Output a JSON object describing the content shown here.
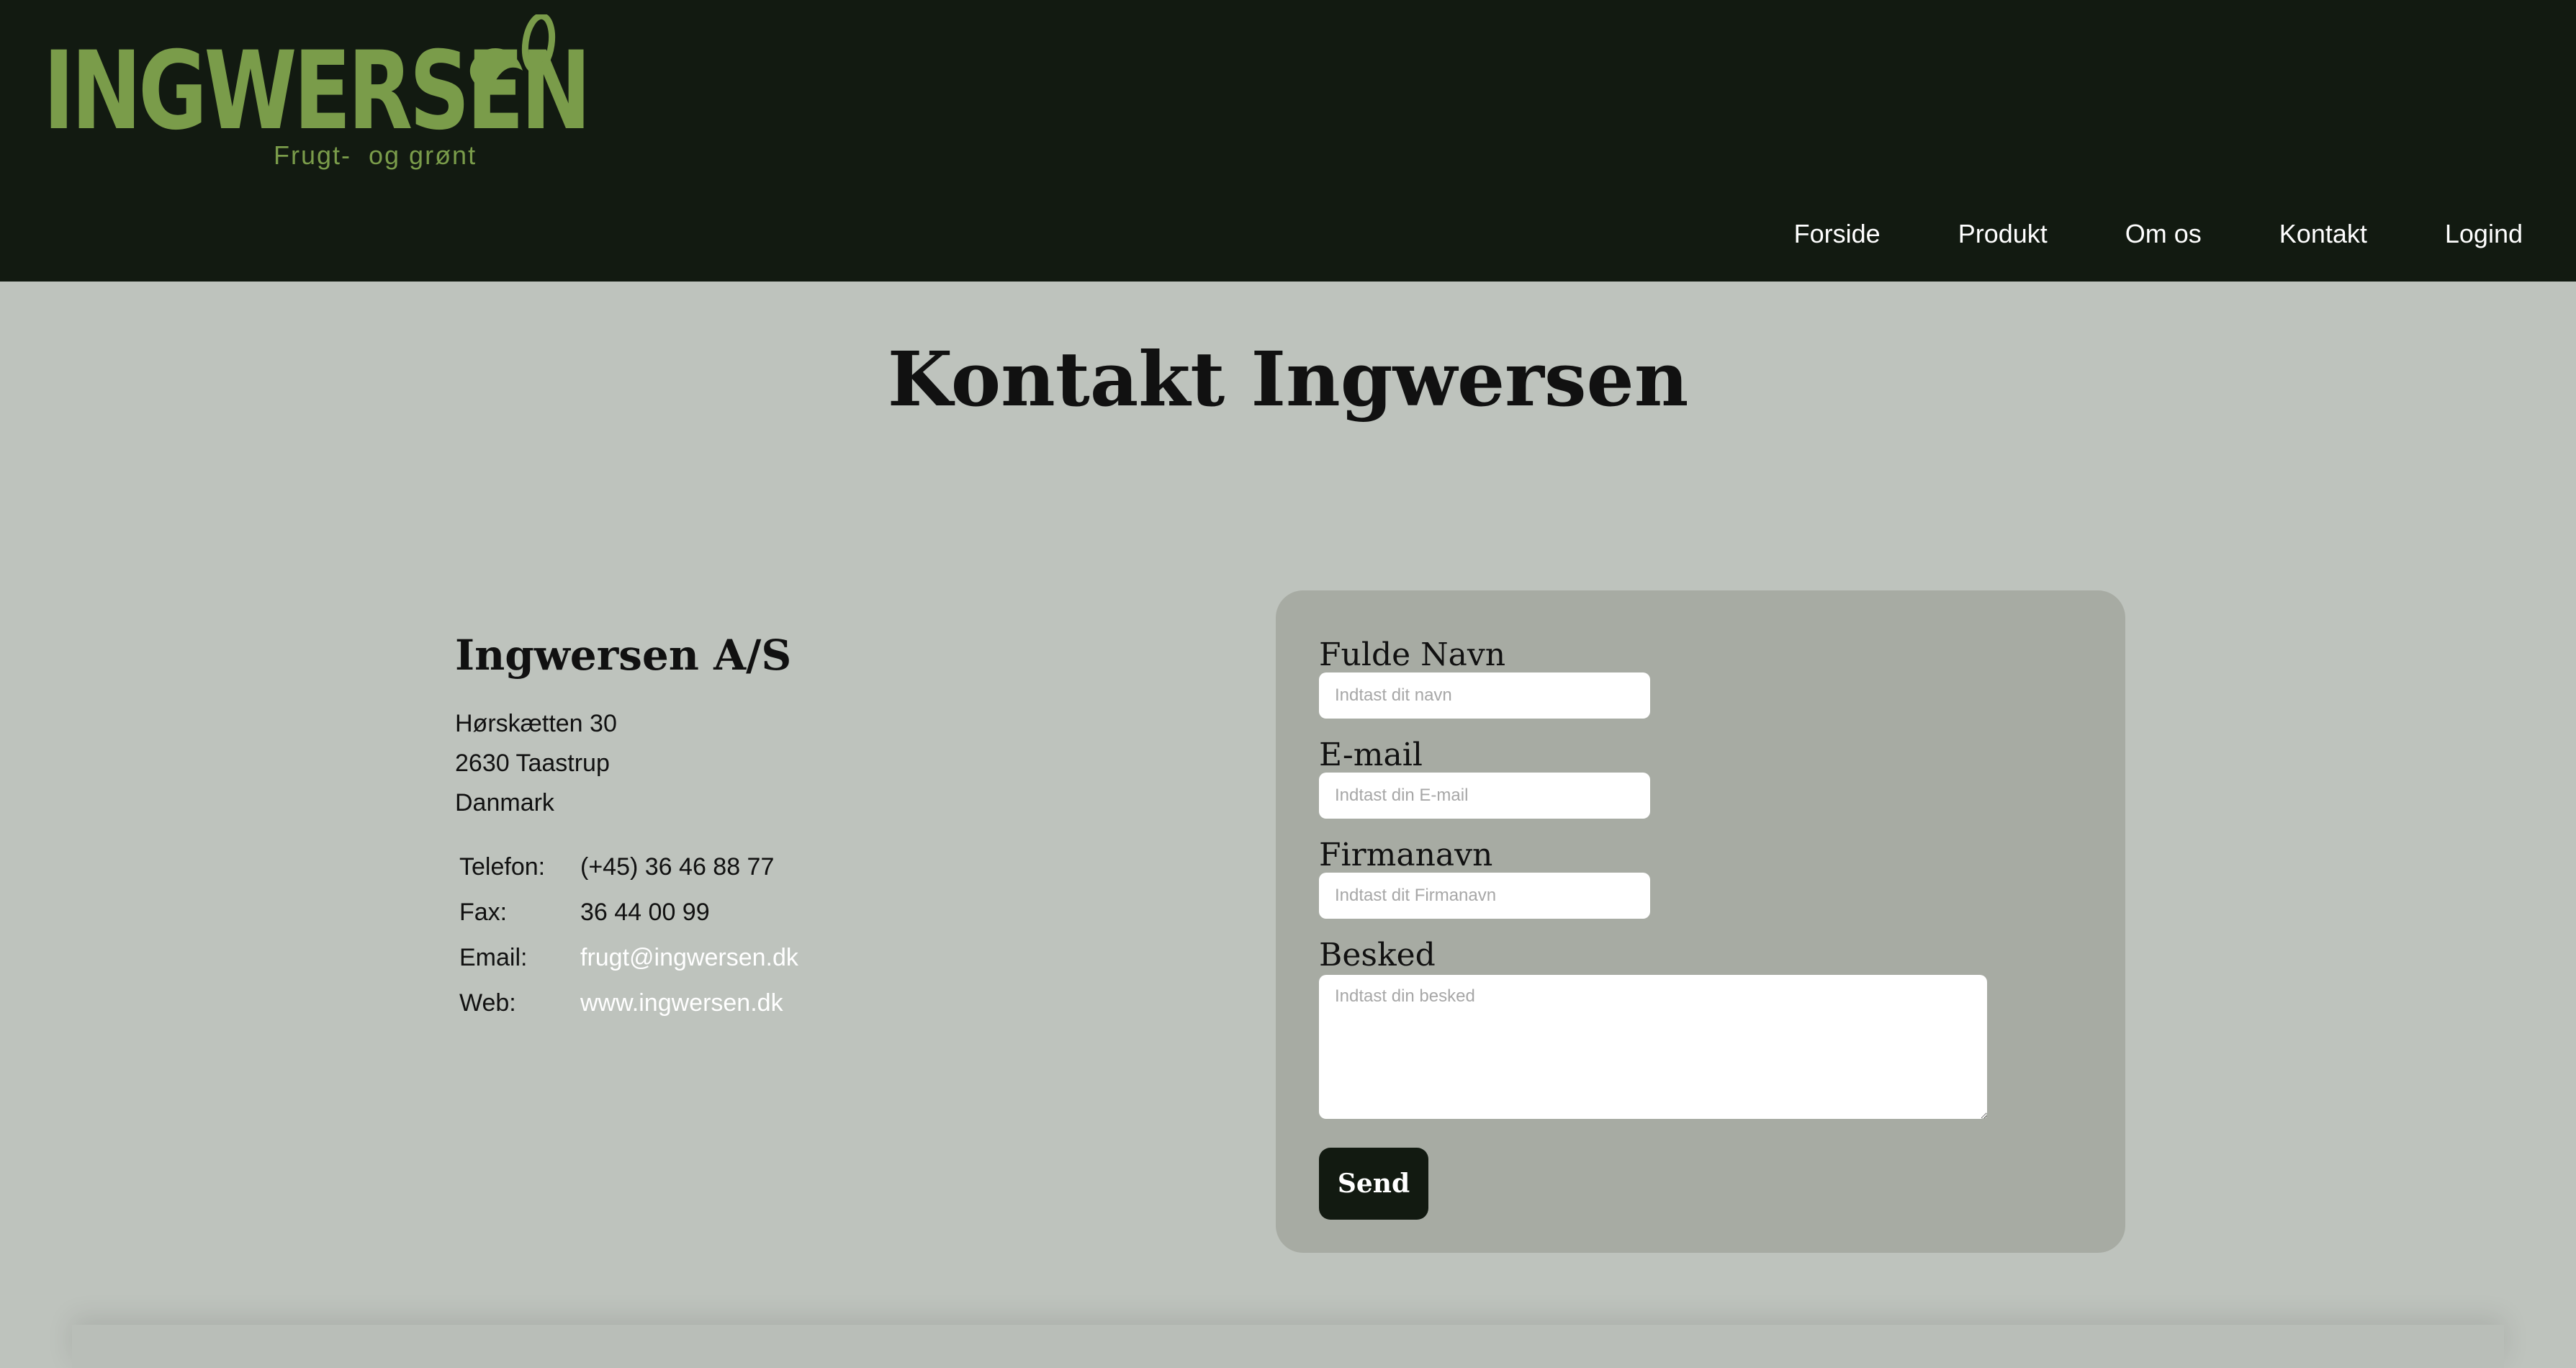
{
  "header": {
    "logo_text": "INGWERSEN",
    "logo_subtitle": "Frugt-  og grønt",
    "nav": [
      {
        "label": "Forside"
      },
      {
        "label": "Produkt"
      },
      {
        "label": "Om os"
      },
      {
        "label": "Kontakt"
      },
      {
        "label": "Logind"
      }
    ]
  },
  "main": {
    "title": "Kontakt Ingwersen"
  },
  "info": {
    "company": "Ingwersen A/S",
    "address": [
      "Hørskætten 30",
      "2630 Taastrup",
      "Danmark"
    ],
    "contacts": [
      {
        "label": "Telefon:",
        "value": "(+45) 36 46 88 77"
      },
      {
        "label": "Fax:",
        "value": "36 44 00 99"
      },
      {
        "label": "Email:",
        "value": "frugt@ingwersen.dk"
      },
      {
        "label": "Web:",
        "value": "www.ingwersen.dk"
      }
    ]
  },
  "form": {
    "name_label": "Fulde Navn",
    "name_placeholder": "Indtast dit navn",
    "name_value": "",
    "email_label": "E-mail",
    "email_placeholder": "Indtast din E-mail",
    "email_value": "",
    "company_label": "Firmanavn",
    "company_placeholder": "Indtast dit Firmanavn",
    "company_value": "",
    "message_label": "Besked",
    "message_placeholder": "Indtast din besked",
    "message_value": "",
    "submit_label": "Send"
  },
  "colors": {
    "header_bg": "#121a11",
    "page_bg": "#bec3bd",
    "panel_bg": "#a7aba3",
    "brand_green": "#7a9c4a",
    "button_bg": "#121a11",
    "link": "#ffffff"
  },
  "icons": {
    "logo_leaf": "leaf-icon"
  }
}
